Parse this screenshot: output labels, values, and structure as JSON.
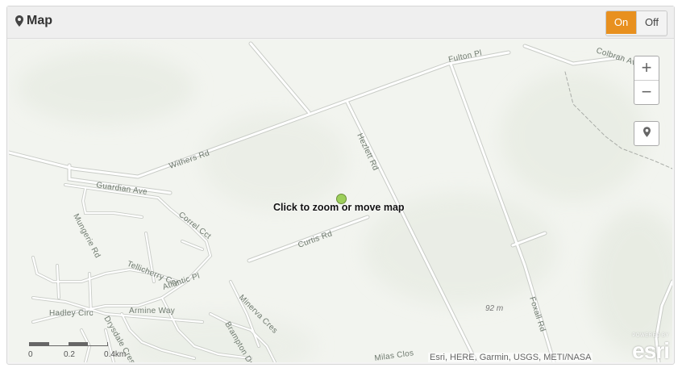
{
  "header": {
    "title": "Map",
    "toggle": {
      "on_label": "On",
      "off_label": "Off",
      "active": "On"
    }
  },
  "map": {
    "click_hint": "Click to zoom or move map",
    "attribution": "Esri, HERE, Garmin, USGS, METI/NASA",
    "logo": {
      "powered_by": "POWERED BY",
      "name": "esri"
    },
    "elevation_label": "92 m",
    "roads": [
      "Withers Rd",
      "Fulton Pl",
      "Colbran Av",
      "Hezlett Rd",
      "Foxall Rd",
      "Curtis Rd",
      "Guardian Ave",
      "Mungerie Rd",
      "Correl Cct",
      "Tellicherry Cct",
      "Atlantic Pl",
      "Armine Way",
      "Drysdale Cres",
      "Minerva Cres",
      "Brampton Dr",
      "Hadley Circ",
      "Milas Clos"
    ],
    "controls": {
      "zoom_in": "+",
      "zoom_out": "−"
    },
    "scale": {
      "labels": [
        "0",
        "0.2",
        "0.4km"
      ]
    }
  }
}
